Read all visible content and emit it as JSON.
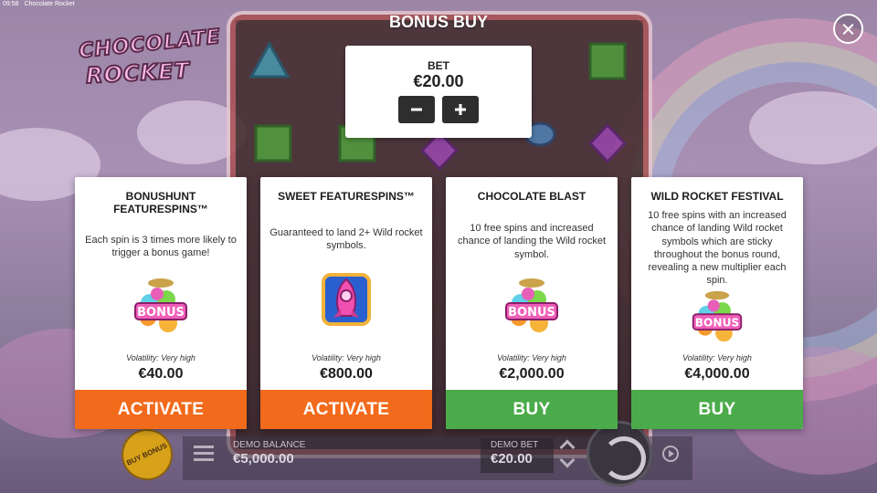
{
  "status_bar": {
    "time": "09:58",
    "window_title": "Chocolate Rocket"
  },
  "logo": {
    "line1": "CHOCOLATE",
    "line2": "ROCKET"
  },
  "modal": {
    "title": "BONUS BUY",
    "bet": {
      "label": "BET",
      "value": "€20.00",
      "decrease_icon": "minus-icon",
      "increase_icon": "plus-icon"
    },
    "close_icon": "close-icon"
  },
  "cards": [
    {
      "title": "BONUSHUNT FEATURESPINS™",
      "description": "Each spin is 3 times more likely to trigger a bonus game!",
      "image": "bonus-candy-jar-icon",
      "volatility": "Volatility: Very high",
      "price": "€40.00",
      "button_label": "ACTIVATE",
      "button_color": "#f26a1b"
    },
    {
      "title": "SWEET FEATURESPINS™",
      "description": "Guaranteed to land 2+ Wild rocket symbols.",
      "image": "wild-rocket-icon",
      "volatility": "Volatility: Very high",
      "price": "€800.00",
      "button_label": "ACTIVATE",
      "button_color": "#f26a1b"
    },
    {
      "title": "CHOCOLATE BLAST",
      "description": "10 free spins and increased chance of landing the Wild rocket symbol.",
      "image": "bonus-candy-jar-icon",
      "volatility": "Volatility: Very high",
      "price": "€2,000.00",
      "button_label": "BUY",
      "button_color": "#4bab4a"
    },
    {
      "title": "WILD ROCKET FESTIVAL",
      "description": "10 free spins with an increased chance of landing Wild rocket symbols which are sticky throughout the bonus round, revealing a new multiplier each spin.",
      "image": "bonus-candy-jar-icon",
      "volatility": "Volatility: Very high",
      "price": "€4,000.00",
      "button_label": "BUY",
      "button_color": "#4bab4a"
    }
  ],
  "bottom_bar": {
    "buy_bonus_label": "BUY BONUS",
    "balance_label": "DEMO BALANCE",
    "balance_value": "€5,000.00",
    "bet_label": "DEMO BET",
    "bet_value": "€20.00"
  }
}
